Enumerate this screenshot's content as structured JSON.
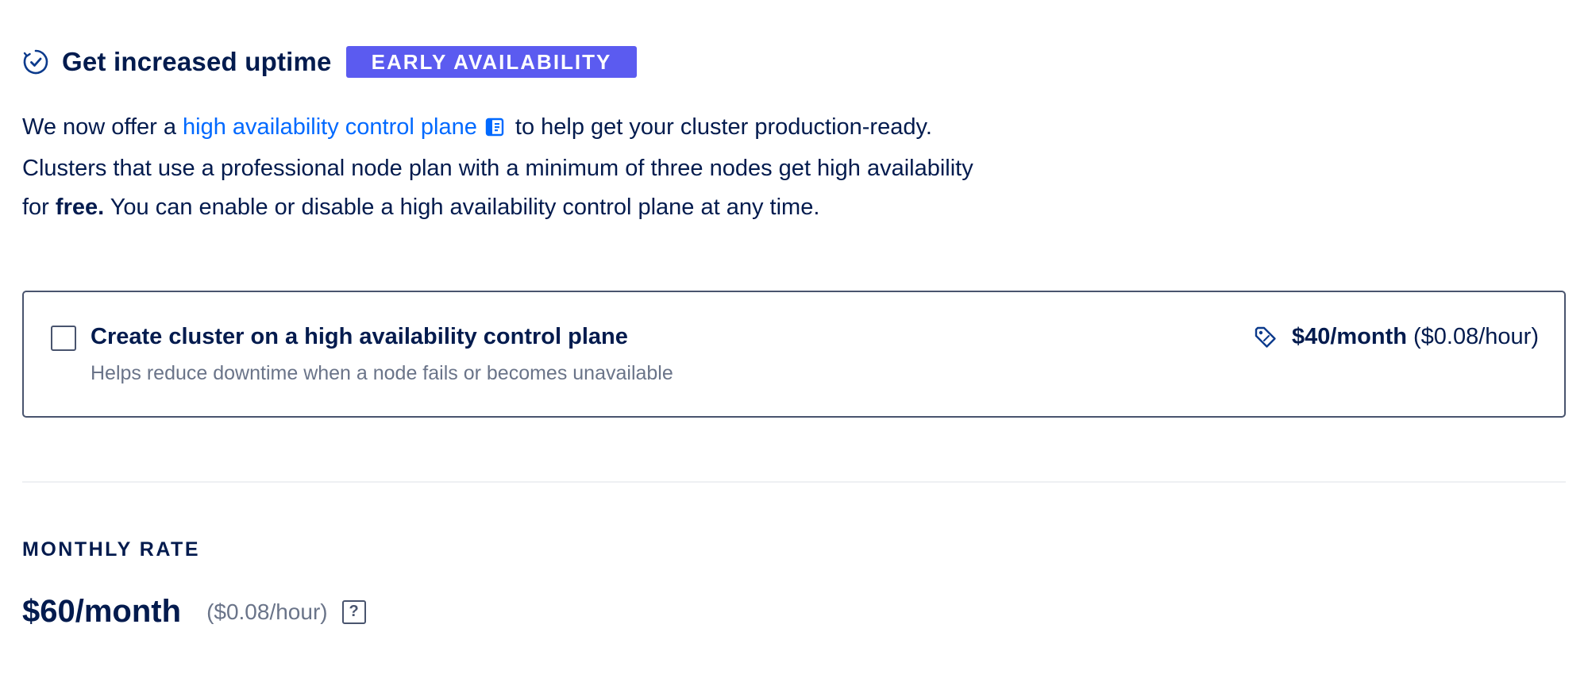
{
  "header": {
    "icon": "check-circle-icon",
    "title": "Get increased uptime",
    "badge": "EARLY AVAILABILITY"
  },
  "description": {
    "intro": "We now offer a",
    "link_text": "high availability control plane",
    "link_icon": "docs-icon",
    "after_link": "to help get your cluster production-ready. Clusters that use a professional node plan with a minimum of three nodes get high availability for",
    "emphasis": "free.",
    "ending": "You can enable or disable a high availability control plane at any time."
  },
  "ha_option": {
    "checked": false,
    "title": "Create cluster on a high availability control plane",
    "subtitle": "Helps reduce downtime when a node fails or becomes unavailable",
    "price_icon": "price-tag-icon",
    "price_amount": "$40",
    "price_period": "/month",
    "price_hourly": "($0.08/hour)"
  },
  "monthly_rate": {
    "heading": "MONTHLY RATE",
    "amount": "$60",
    "period": "/month",
    "hourly": "($0.08/hour)",
    "help_label": "?"
  },
  "colors": {
    "text": "#031b4e",
    "link": "#0069ff",
    "badge": "#5b5bf0",
    "muted": "#6a7489",
    "border": "#49546e"
  }
}
